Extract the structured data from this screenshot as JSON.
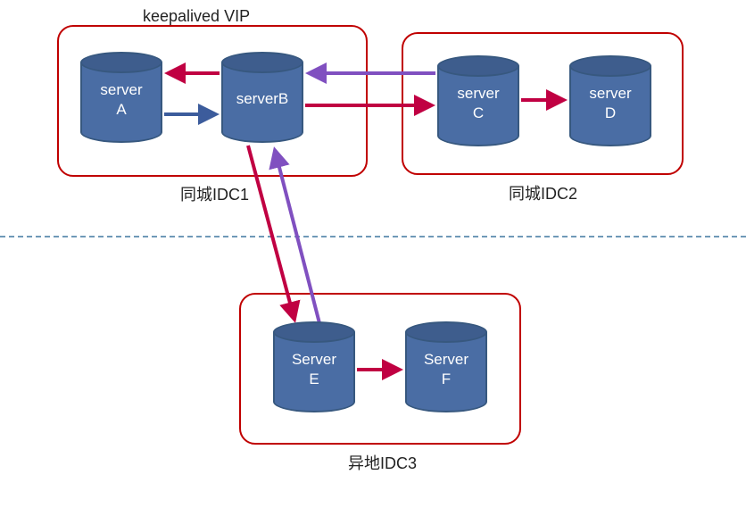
{
  "title": "keepalived VIP",
  "colors": {
    "border": "#c00000",
    "cylinder_fill": "#4a6da4",
    "cylinder_top": "#3e5d8d",
    "arrow_red": "#c00042",
    "arrow_blue": "#3c5c9c",
    "arrow_purple": "#8050c0",
    "divider": "#6f99b8"
  },
  "containers": {
    "idc1": {
      "label": "同城IDC1"
    },
    "idc2": {
      "label": "同城IDC2"
    },
    "idc3": {
      "label": "异地IDC3"
    }
  },
  "servers": {
    "a": {
      "line1": "server",
      "line2": "A"
    },
    "b": {
      "line1": "serverB",
      "line2": ""
    },
    "c": {
      "line1": "server",
      "line2": "C"
    },
    "d": {
      "line1": "server",
      "line2": "D"
    },
    "e": {
      "line1": "Server",
      "line2": "E"
    },
    "f": {
      "line1": "Server",
      "line2": "F"
    }
  },
  "connections": [
    {
      "from": "A",
      "to": "B",
      "color": "blue"
    },
    {
      "from": "B",
      "to": "A",
      "color": "red"
    },
    {
      "from": "B",
      "to": "C",
      "color": "red"
    },
    {
      "from": "C",
      "to": "B",
      "color": "purple"
    },
    {
      "from": "C",
      "to": "D",
      "color": "red"
    },
    {
      "from": "B",
      "to": "E",
      "color": "red"
    },
    {
      "from": "E",
      "to": "B",
      "color": "purple"
    },
    {
      "from": "E",
      "to": "F",
      "color": "red"
    }
  ]
}
